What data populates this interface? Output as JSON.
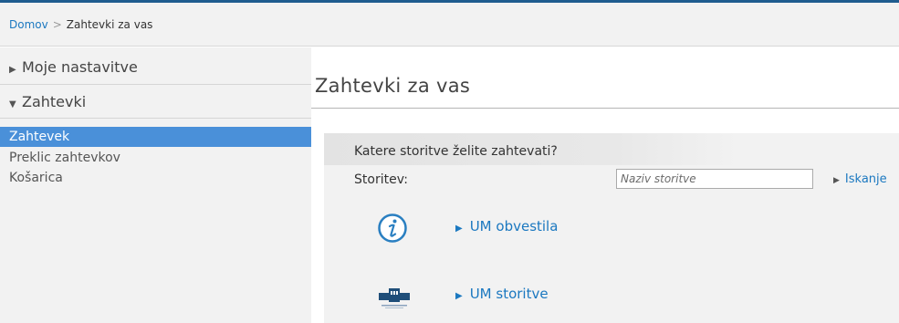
{
  "breadcrumb": {
    "home": "Domov",
    "separator": ">",
    "current": "Zahtevki za vas"
  },
  "sidebar": {
    "sections": [
      {
        "label": "Moje nastavitve",
        "expanded": false
      },
      {
        "label": "Zahtevki",
        "expanded": true
      }
    ],
    "items": [
      {
        "label": "Zahtevek",
        "active": true
      },
      {
        "label": "Preklic zahtevkov",
        "active": false
      },
      {
        "label": "Košarica",
        "active": false
      }
    ]
  },
  "main": {
    "title": "Zahtevki za vas",
    "panel": {
      "question": "Katere storitve želite zahtevati?",
      "field_label": "Storitev:",
      "search_placeholder": "Naziv storitve",
      "search_value": "",
      "search_button": "Iskanje",
      "services": [
        {
          "label": "UM obvestila",
          "icon": "info-icon"
        },
        {
          "label": "UM storitve",
          "icon": "um-logo"
        }
      ]
    }
  },
  "colors": {
    "link": "#1b78c0",
    "active_menu": "#4a90d9",
    "top_line": "#1f5c8f",
    "panel_bg": "#f2f2f2"
  }
}
